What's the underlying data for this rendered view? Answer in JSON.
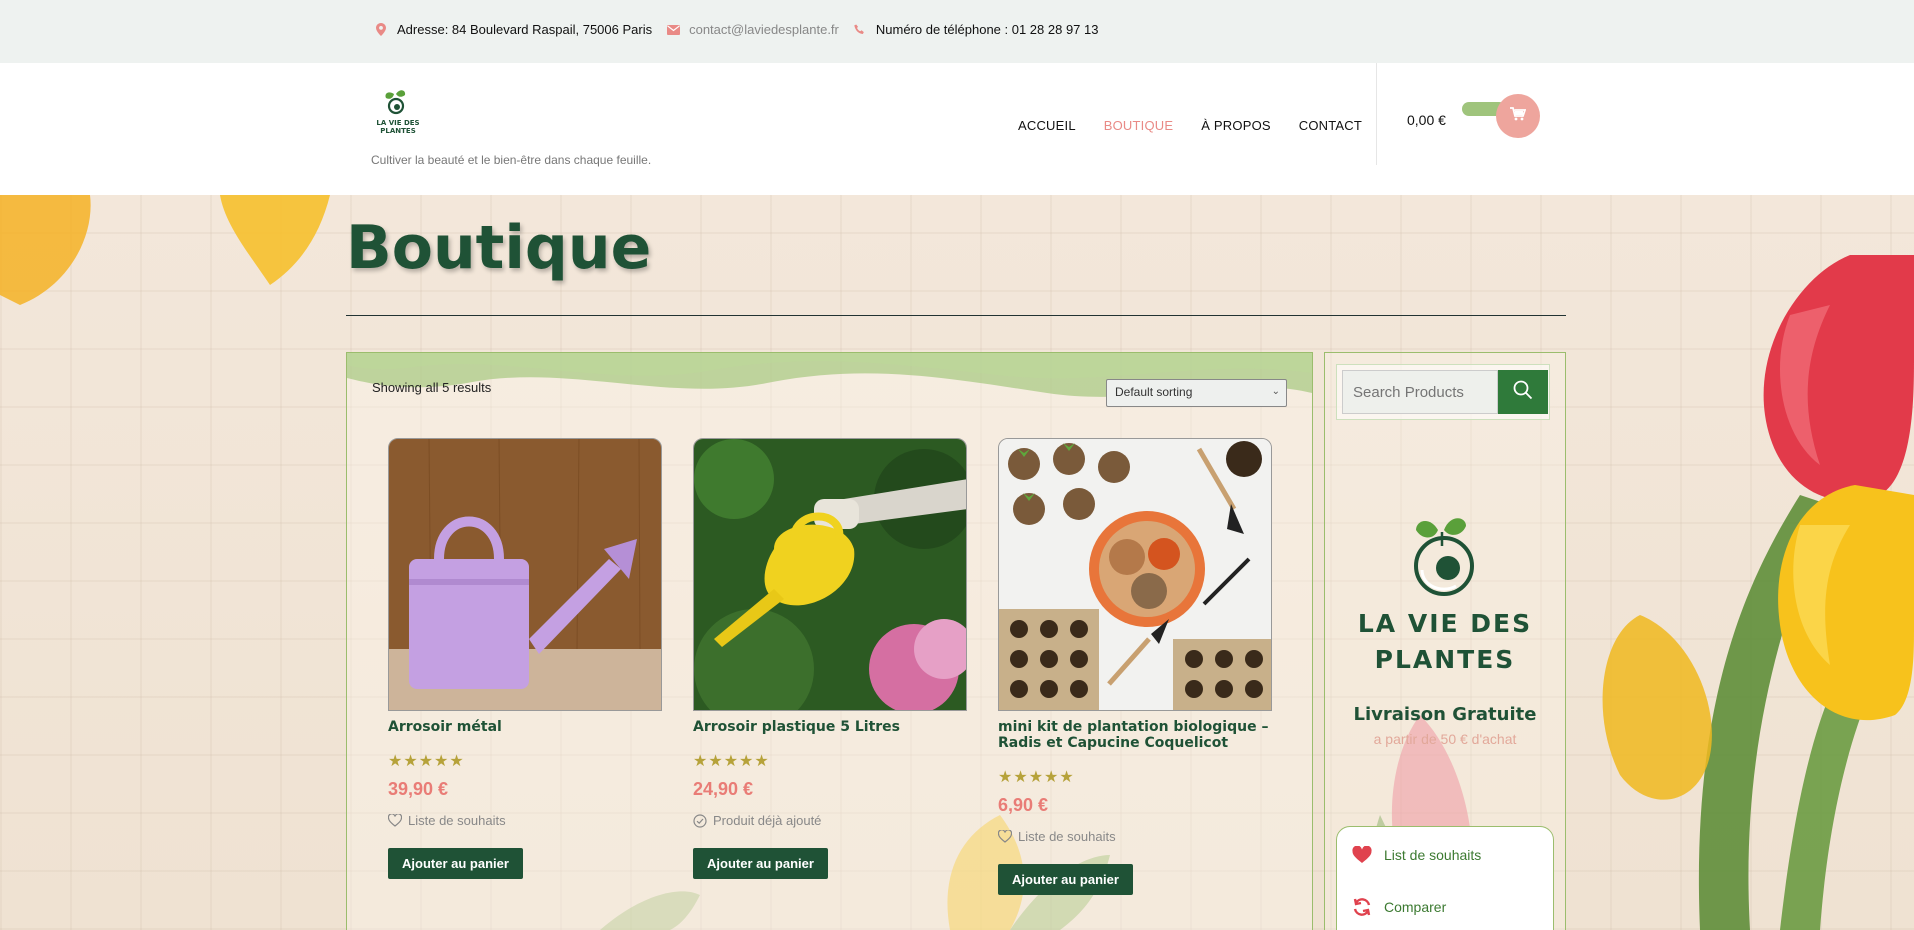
{
  "topbar": {
    "address": "Adresse: 84 Boulevard Raspail, 75006 Paris",
    "email": "contact@laviedesplante.fr",
    "phone": "Numéro de téléphone : 01 28 28 97 13",
    "icons": [
      "map-pin-icon",
      "mail-icon",
      "phone-icon"
    ],
    "accent_color": "#e98a86"
  },
  "header": {
    "logo_text": "LA VIE DES PLANTES",
    "tagline": "Cultiver la beauté et le bien-être dans chaque feuille.",
    "nav": [
      {
        "label": "ACCUEIL",
        "active": false
      },
      {
        "label": "BOUTIQUE",
        "active": true
      },
      {
        "label": "À PROPOS",
        "active": false
      },
      {
        "label": "CONTACT",
        "active": false
      }
    ],
    "cart_amount": "0,00 €",
    "cart_icon": "shopping-cart-icon"
  },
  "page": {
    "title": "Boutique",
    "result_count": "Showing all 5 results",
    "sorting_selected": "Default sorting"
  },
  "products": [
    {
      "name": "Arrosoir métal",
      "stars": "★★★★★",
      "rating": 5,
      "price": "39,90 €",
      "wish_label": "Liste de souhaits",
      "wish_icon": "heart-outline-icon",
      "button": "Ajouter au panier",
      "image": "purple-watering-can"
    },
    {
      "name": "Arrosoir plastique 5 Litres",
      "stars": "★★★★★",
      "rating": 5,
      "price": "24,90 €",
      "wish_label": "Produit déjà ajouté",
      "wish_icon": "check-circle-icon",
      "button": "Ajouter au panier",
      "image": "yellow-watering-can"
    },
    {
      "name": "mini kit de plantation biologique – Radis et Capucine Coquelicot",
      "stars": "★★★★★",
      "rating": 5,
      "price": "6,90 €",
      "wish_label": "Liste de souhaits",
      "wish_icon": "heart-outline-icon",
      "button": "Ajouter au panier",
      "image": "planting-kit"
    }
  ],
  "sidebar": {
    "search_placeholder": "Search Products",
    "brand_line1": "LA VIE DES",
    "brand_line2": "PLANTES",
    "free_shipping": "Livraison Gratuite",
    "free_shipping_sub": "a partir de 50 € d'achat",
    "links": [
      {
        "label": "List de souhaits",
        "icon": "heart-icon"
      },
      {
        "label": "Comparer",
        "icon": "refresh-icon"
      }
    ]
  },
  "colors": {
    "brand_green": "#1f5236",
    "price_red": "#e97c76",
    "border_green": "#9bbd6d",
    "star_gold": "#b6a23a"
  }
}
